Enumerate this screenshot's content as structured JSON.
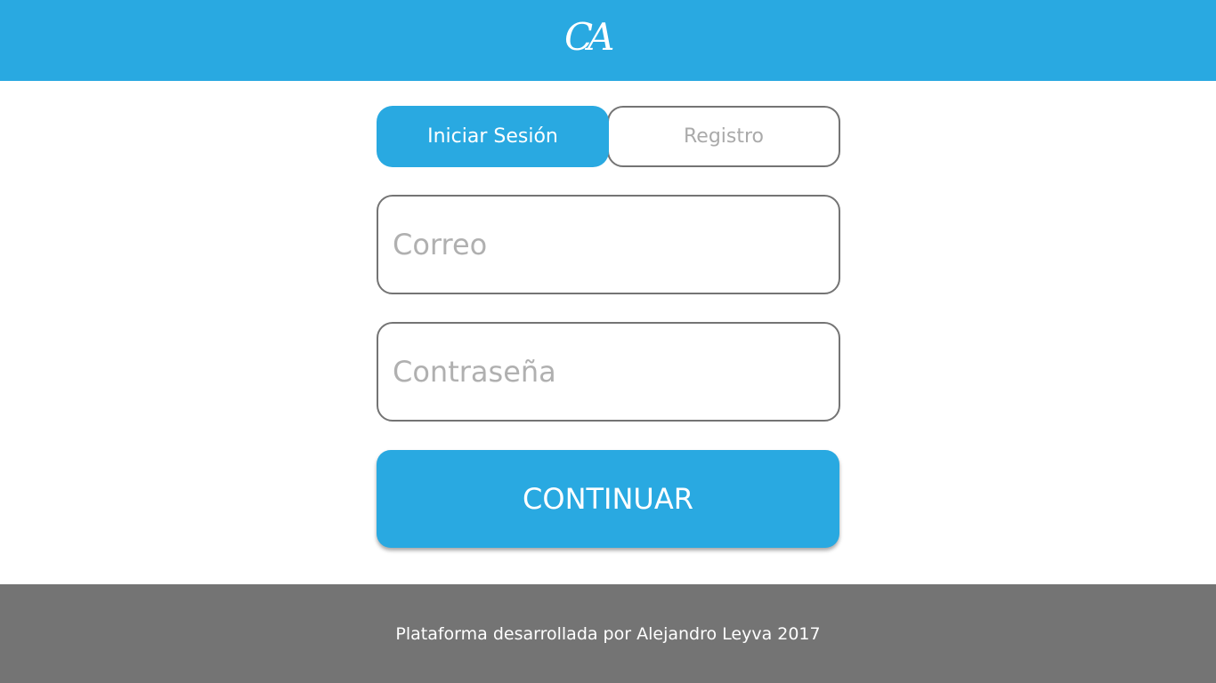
{
  "header": {
    "logo_text": "CA"
  },
  "tabs": [
    {
      "label": "Iniciar Sesión",
      "active": true
    },
    {
      "label": "Registro",
      "active": false
    }
  ],
  "form": {
    "email_placeholder": "Correo",
    "email_value": "",
    "password_placeholder": "Contraseña",
    "password_value": "",
    "submit_label": "CONTINUAR"
  },
  "footer": {
    "text": "Plataforma desarrollada por Alejandro Leyva 2017"
  },
  "colors": {
    "accent": "#29a9e1",
    "footer_bg": "#747474",
    "border": "#747474",
    "placeholder": "#b0b0b0"
  }
}
